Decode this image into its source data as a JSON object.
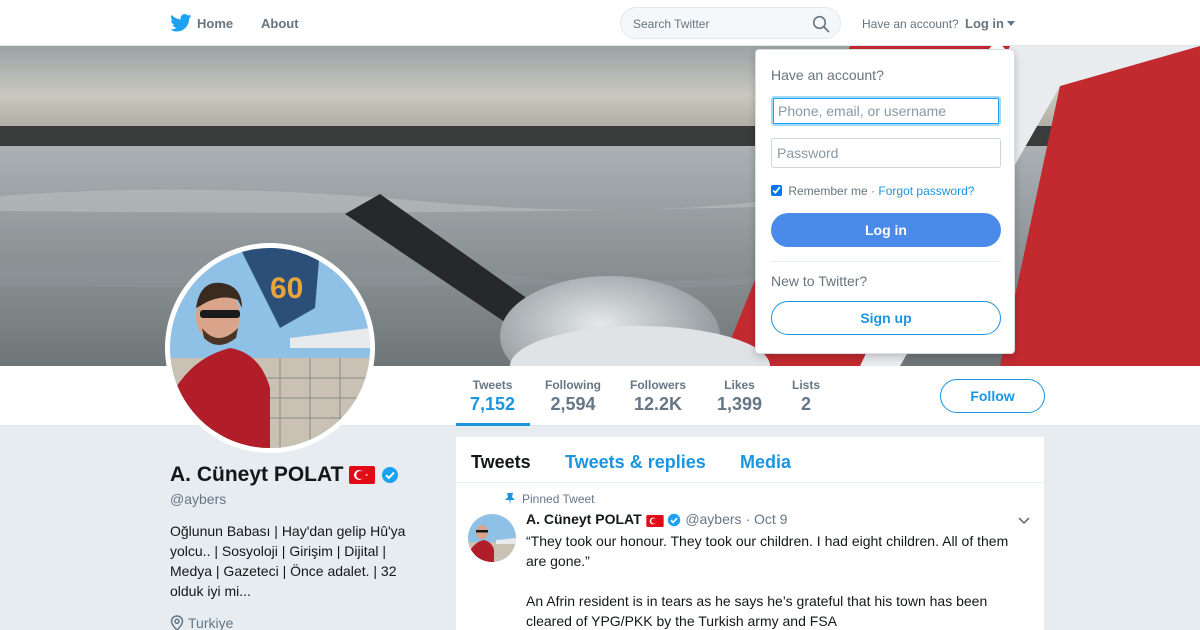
{
  "nav": {
    "logo_icon": "twitter-bird-icon",
    "home": "Home",
    "about": "About",
    "search_placeholder": "Search Twitter",
    "have_account": "Have an account?",
    "login": "Log in"
  },
  "profile": {
    "name": "A. Cüneyt POLAT",
    "handle": "@aybers",
    "bio": "Oğlunun Babası | Hay'dan gelip Hû'ya yolcu.. | Sosyoloji | Girişim | Dijital | Medya | Gazeteci | Önce adalet. | 32 olduk iyi mi...",
    "location": "Turkiye"
  },
  "stats": [
    {
      "label": "Tweets",
      "value": "7,152"
    },
    {
      "label": "Following",
      "value": "2,594"
    },
    {
      "label": "Followers",
      "value": "12.2K"
    },
    {
      "label": "Likes",
      "value": "1,399"
    },
    {
      "label": "Lists",
      "value": "2"
    }
  ],
  "follow_label": "Follow",
  "timeline": {
    "tabs": [
      "Tweets",
      "Tweets & replies",
      "Media"
    ],
    "pinned_label": "Pinned Tweet",
    "tweet": {
      "name": "A. Cüneyt POLAT",
      "handle": "@aybers",
      "date": "Oct 9",
      "text": "“They took our honour. They took our children. I had eight children. All of them are gone.”\n\nAn Afrin resident is in tears as he says he’s grateful that his town has been cleared of YPG/PKK by the Turkish army and FSA"
    }
  },
  "login_dropdown": {
    "title": "Have an account?",
    "username_placeholder": "Phone, email, or username",
    "password_placeholder": "Password",
    "remember": "Remember me",
    "separator": "·",
    "forgot": "Forgot password?",
    "login_button": "Log in",
    "new_to_twitter": "New to Twitter?",
    "signup_button": "Sign up"
  },
  "colors": {
    "accent": "#1b95e0",
    "login_button": "#4a8ae8",
    "flag_red": "#e30a17",
    "background": "#e6ecf0"
  }
}
